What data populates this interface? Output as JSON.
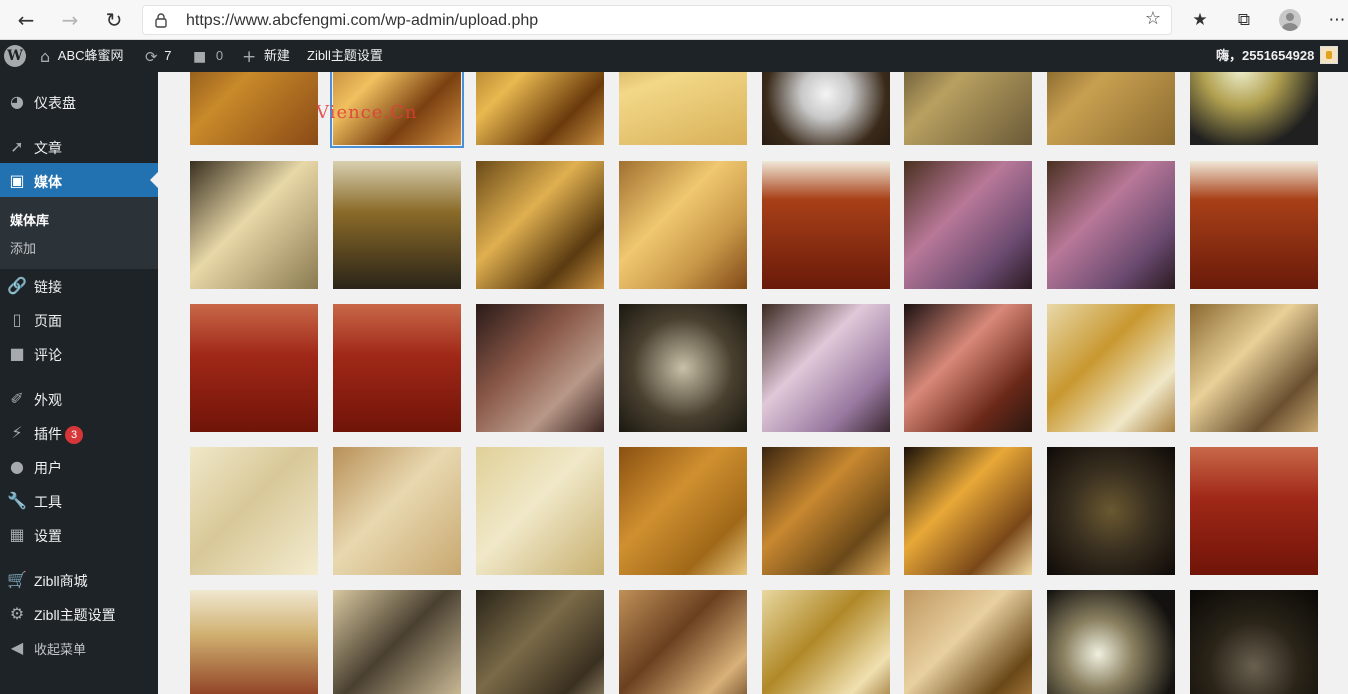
{
  "browser": {
    "url": "https://www.abcfengmi.com/wp-admin/upload.php"
  },
  "adminbar": {
    "site_name": "ABC蜂蜜网",
    "updates_count": "7",
    "comments_count": "0",
    "new_label": "新建",
    "theme_settings": "Zibll主题设置",
    "greeting": "嗨，2551654928"
  },
  "sidebar": {
    "items": [
      {
        "label": "仪表盘",
        "icon": "dashboard-icon"
      },
      {
        "label": "文章",
        "icon": "pin-icon"
      },
      {
        "label": "媒体",
        "icon": "media-icon"
      },
      {
        "label": "链接",
        "icon": "link-icon"
      },
      {
        "label": "页面",
        "icon": "page-icon"
      },
      {
        "label": "评论",
        "icon": "comment-icon"
      },
      {
        "label": "外观",
        "icon": "brush-icon"
      },
      {
        "label": "插件",
        "icon": "plugin-icon",
        "badge": "3"
      },
      {
        "label": "用户",
        "icon": "user-icon"
      },
      {
        "label": "工具",
        "icon": "wrench-icon"
      },
      {
        "label": "设置",
        "icon": "settings-icon"
      },
      {
        "label": "Zibll商城",
        "icon": "cart-icon"
      },
      {
        "label": "Zibll主题设置",
        "icon": "gear-icon"
      },
      {
        "label": "收起菜单",
        "icon": "collapse-icon"
      }
    ],
    "submenu": {
      "current": "媒体库",
      "add": "添加"
    }
  },
  "watermark": "Vience.Cn",
  "media_tiles": [
    {
      "bg": "linear-gradient(135deg,#6b3a12 0%,#c98a2a 45%,#8a4a16 100%)"
    },
    {
      "bg": "linear-gradient(135deg,#a0601a 0%,#f0c060 40%,#7a4010 70%,#d09040 100%)"
    },
    {
      "bg": "linear-gradient(135deg,#8a5a18 0%,#e8b850 40%,#6a3a0c 75%,#c89040 100%)"
    },
    {
      "bg": "linear-gradient(160deg,#b08028 0%,#f2d888 45%,#d8b058 100%)"
    },
    {
      "bg": "radial-gradient(circle at 50% 60%,#f4f4f4 0%,#c8c8c8 25%,#3a2a1a 60%,#1a120a 100%)"
    },
    {
      "bg": "linear-gradient(135deg,#3a3020 0%,#b8a060 45%,#6a5a38 100%)"
    },
    {
      "bg": "linear-gradient(135deg,#5a4018 0%,#c8a050 45%,#8a6a30 100%)"
    },
    {
      "bg": "radial-gradient(circle at 40% 40%,#f0f0d0 0%,#b0a050 35%,#202020 75%)"
    },
    {
      "bg": "linear-gradient(135deg,#3a3020 0%,#e8d8a8 45%,#8a7a50 100%)"
    },
    {
      "bg": "linear-gradient(180deg,#d8d0b0 0%,#8a6a28 40%,#2a2418 100%)"
    },
    {
      "bg": "linear-gradient(135deg,#6a4a18 0%,#e0b050 40%,#5a3a10 75%,#c89040 100%)"
    },
    {
      "bg": "linear-gradient(135deg,#a07030 0%,#f0c870 40%,#c89848 70%,#804818 100%)"
    },
    {
      "bg": "linear-gradient(180deg,#f0e8d8 0%,#a84018 30%,#6a1a0a 100%)"
    },
    {
      "bg": "linear-gradient(135deg,#4a3020 0%,#b87898 40%,#6a4a70 75%,#2a1a20 100%)"
    },
    {
      "bg": "linear-gradient(135deg,#4a3020 0%,#b87898 40%,#6a4a70 75%,#2a1a20 100%)"
    },
    {
      "bg": "linear-gradient(180deg,#f0e8d8 0%,#a84018 30%,#6a1a0a 100%)"
    },
    {
      "bg": "linear-gradient(180deg,#c86848 0%,#a02818 40%,#701408 100%)"
    },
    {
      "bg": "linear-gradient(180deg,#c86848 0%,#a02818 40%,#701408 100%)"
    },
    {
      "bg": "linear-gradient(135deg,#2a1a18 0%,#8a5848 40%,#b89888 70%,#3a2420 100%)"
    },
    {
      "bg": "radial-gradient(circle at 50% 50%,#c8c0a8 0%,#4a4030 55%,#1a1810 100%)"
    },
    {
      "bg": "linear-gradient(135deg,#3a2820 0%,#e0c8d8 40%,#9878a0 75%,#3a2830 100%)"
    },
    {
      "bg": "linear-gradient(135deg,#1a1010 0%,#d88878 40%,#6a2818 75%,#2a1810 100%)"
    },
    {
      "bg": "linear-gradient(135deg,#e8d8a8 0%,#c89830 40%,#f0e8c8 75%,#a88040 100%)"
    },
    {
      "bg": "linear-gradient(135deg,#8a6a30 0%,#e8d098 40%,#6a5030 75%,#c8a870 100%)"
    },
    {
      "bg": "linear-gradient(135deg,#f0e8c8 0%,#d8c898 45%,#f4ecd0 100%)"
    },
    {
      "bg": "linear-gradient(135deg,#b89058 0%,#e8d8b0 45%,#c8a870 100%)"
    },
    {
      "bg": "linear-gradient(135deg,#e0d098 0%,#f0e8c8 45%,#c8b070 100%)"
    },
    {
      "bg": "linear-gradient(135deg,#8a5010 0%,#d09030 40%,#a06818 75%,#e8c880 100%)"
    },
    {
      "bg": "linear-gradient(135deg,#3a2410 0%,#c88830 40%,#6a4818 75%,#e0b060 100%)"
    },
    {
      "bg": "linear-gradient(135deg,#1a1008 0%,#e8a838 40%,#7a4818 75%,#f0d8a0 100%)"
    },
    {
      "bg": "radial-gradient(circle at 50% 50%,#6a5830 0%,#3a3020 45%,#0e0a08 100%)"
    },
    {
      "bg": "linear-gradient(180deg,#c86848 0%,#a02818 40%,#701408 100%)"
    },
    {
      "bg": "linear-gradient(180deg,#f0e8d0 0%,#d0b070 35%,#7a1a0a 100%)"
    },
    {
      "bg": "linear-gradient(135deg,#d8c8a0 0%,#4a4030 45%,#e0d0a8 100%)"
    },
    {
      "bg": "linear-gradient(135deg,#2a2418 0%,#7a6a48 40%,#3a3020 75%,#a89878 100%)"
    },
    {
      "bg": "linear-gradient(135deg,#c09058 0%,#6a4020 40%,#d8b078 75%,#5a3818 100%)"
    },
    {
      "bg": "linear-gradient(135deg,#e8d8a0 0%,#b08828 40%,#f0e0b0 75%,#8a6020 100%)"
    },
    {
      "bg": "linear-gradient(135deg,#c09860 0%,#e8d0a0 40%,#6a4818 75%,#b88848 100%)"
    },
    {
      "bg": "radial-gradient(circle at 40% 50%,#f0f0e0 0%,#8a8060 35%,#141210 80%)"
    },
    {
      "bg": "radial-gradient(circle at 50% 60%,#6a6050 0%,#2a2418 45%,#0a0806 100%)"
    }
  ]
}
